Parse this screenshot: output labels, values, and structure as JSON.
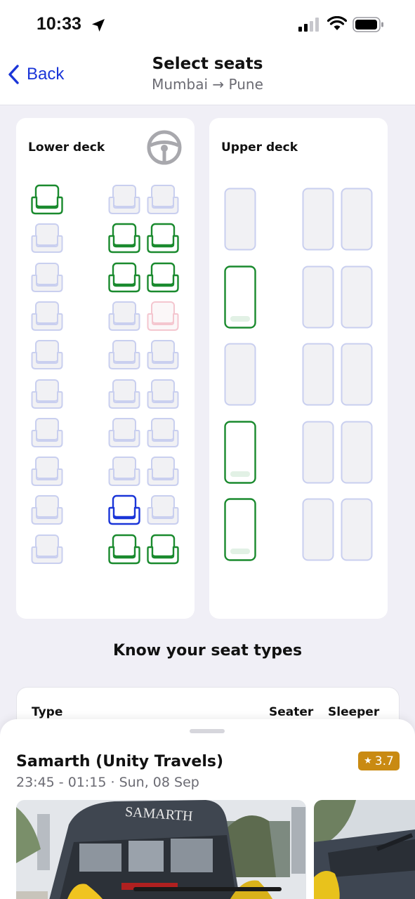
{
  "status": {
    "time": "10:33",
    "icons": [
      "location-arrow-icon",
      "cellular-signal-icon",
      "wifi-icon",
      "battery-icon"
    ]
  },
  "nav": {
    "back_label": "Back",
    "title": "Select seats",
    "subtitle": "Mumbai → Pune"
  },
  "colors": {
    "accent": "#1a35d8",
    "available": "#1a8a2e",
    "booked": "#c9cfef",
    "ladies_booked": "#f4c6cf",
    "selected": "#1a35d8",
    "rating_bg": "#c98a12"
  },
  "lower_deck": {
    "title": "Lower deck",
    "icon": "steering-wheel-icon",
    "rows": [
      [
        "available",
        "booked",
        "booked"
      ],
      [
        "booked",
        "available",
        "available"
      ],
      [
        "booked",
        "available",
        "available"
      ],
      [
        "booked",
        "booked",
        "ladies-booked"
      ],
      [
        "booked",
        "booked",
        "booked"
      ],
      [
        "booked",
        "booked",
        "booked"
      ],
      [
        "booked",
        "booked",
        "booked"
      ],
      [
        "booked",
        "booked",
        "booked"
      ],
      [
        "booked",
        "selected",
        "booked"
      ],
      [
        "booked",
        "available",
        "available"
      ]
    ]
  },
  "upper_deck": {
    "title": "Upper deck",
    "rows": [
      [
        "booked",
        "booked",
        "booked"
      ],
      [
        "available",
        "booked",
        "booked"
      ],
      [
        "booked",
        "booked",
        "booked"
      ],
      [
        "available",
        "booked",
        "booked"
      ],
      [
        "available",
        "booked",
        "booked"
      ]
    ]
  },
  "seat_types": {
    "title": "Know your seat types",
    "col_type": "Type",
    "col_seater": "Seater",
    "col_sleeper": "Sleeper"
  },
  "bus": {
    "operator": "Samarth (Unity Travels)",
    "rating": "3.7",
    "rating_icon": "star-icon",
    "timing": "23:45 - 01:15 · Sun, 08 Sep",
    "photos": [
      "bus-photo-exterior",
      "bus-photo-interior"
    ]
  }
}
